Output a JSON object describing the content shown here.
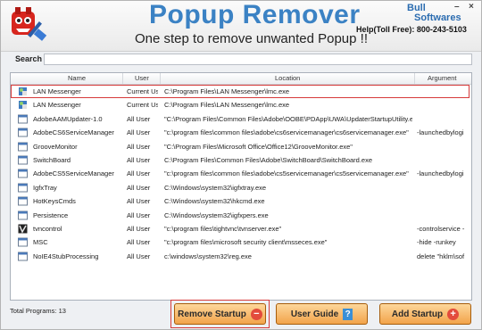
{
  "header": {
    "title": "Popup Remover",
    "tagline": "One step to remove unwanted Popup !!",
    "brand_top": "Bull",
    "brand_bottom": "Softwares",
    "help": "Help(Toll Free): 800-243-5103",
    "minimize": "–",
    "close": "×"
  },
  "search": {
    "label": "Search",
    "value": ""
  },
  "table": {
    "columns": [
      "Name",
      "User",
      "Location",
      "Argument"
    ],
    "rows": [
      {
        "name": "LAN Messenger",
        "user": "Current Us",
        "location": "C:\\Program Files\\LAN Messenger\\lmc.exe",
        "argument": "",
        "icon": "lan-messenger-icon",
        "selected": true
      },
      {
        "name": "LAN Messenger",
        "user": "Current Us",
        "location": "C:\\Program Files\\LAN Messenger\\lmc.exe",
        "argument": "",
        "icon": "lan-messenger-icon",
        "selected": false
      },
      {
        "name": "AdobeAAMUpdater-1.0",
        "user": "All User",
        "location": "\"C:\\Program Files\\Common Files\\Adobe\\OOBE\\PDApp\\UWA\\UpdaterStartupUtility.exe",
        "argument": "",
        "icon": "program-icon",
        "selected": false
      },
      {
        "name": "AdobeCS6ServiceManager",
        "user": "All User",
        "location": "\"c:\\program files\\common files\\adobe\\cs6servicemanager\\cs6servicemanager.exe\"",
        "argument": "-launchedbylogi",
        "icon": "program-icon",
        "selected": false
      },
      {
        "name": "GrooveMonitor",
        "user": "All User",
        "location": "\"C:\\Program Files\\Microsoft Office\\Office12\\GrooveMonitor.exe\"",
        "argument": "",
        "icon": "program-icon",
        "selected": false
      },
      {
        "name": "SwitchBoard",
        "user": "All User",
        "location": "C:\\Program Files\\Common Files\\Adobe\\SwitchBoard\\SwitchBoard.exe",
        "argument": "",
        "icon": "program-icon",
        "selected": false
      },
      {
        "name": "AdobeCS5ServiceManager",
        "user": "All User",
        "location": "\"c:\\program files\\common files\\adobe\\cs5servicemanager\\cs5servicemanager.exe\"",
        "argument": "-launchedbylogi",
        "icon": "program-icon",
        "selected": false
      },
      {
        "name": "IgfxTray",
        "user": "All User",
        "location": "C:\\Windows\\system32\\igfxtray.exe",
        "argument": "",
        "icon": "program-icon",
        "selected": false
      },
      {
        "name": "HotKeysCmds",
        "user": "All User",
        "location": "C:\\Windows\\system32\\hkcmd.exe",
        "argument": "",
        "icon": "program-icon",
        "selected": false
      },
      {
        "name": "Persistence",
        "user": "All User",
        "location": "C:\\Windows\\system32\\igfxpers.exe",
        "argument": "",
        "icon": "program-icon",
        "selected": false
      },
      {
        "name": "tvncontrol",
        "user": "All User",
        "location": "\"c:\\program files\\tightvnc\\tvnserver.exe\"",
        "argument": "-controlservice -",
        "icon": "tightvnc-icon",
        "selected": false
      },
      {
        "name": "MSC",
        "user": "All User",
        "location": "\"c:\\program files\\microsoft security client\\msseces.exe\"",
        "argument": "-hide -runkey",
        "icon": "program-icon",
        "selected": false
      },
      {
        "name": "NoIE4StubProcessing",
        "user": "All User",
        "location": "c:\\windows\\system32\\reg.exe",
        "argument": "delete \"hklm\\sof",
        "icon": "program-icon",
        "selected": false
      }
    ]
  },
  "footer": {
    "total": "Total Programs: 13",
    "remove_label": "Remove Startup",
    "guide_label": "User Guide",
    "add_label": "Add Startup"
  },
  "colors": {
    "title_blue": "#3b82c4",
    "button_orange": "#f2a34a",
    "highlight_red": "#d63a3a"
  }
}
